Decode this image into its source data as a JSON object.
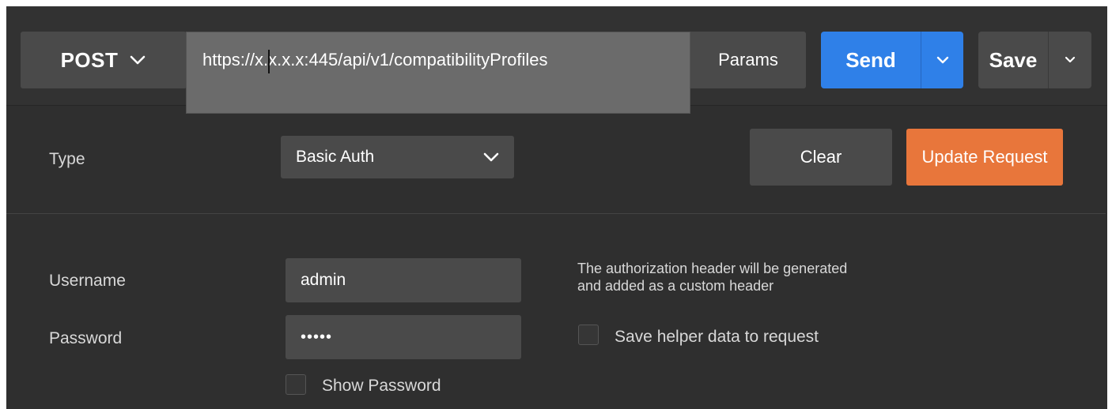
{
  "request": {
    "method": "POST",
    "url": "https://x.x.x.x:445/api/v1/compatibilityProfiles",
    "params_label": "Params",
    "send_label": "Send",
    "save_label": "Save"
  },
  "auth": {
    "type_label": "Type",
    "type_value": "Basic Auth",
    "clear_label": "Clear",
    "update_label": "Update Request",
    "username_label": "Username",
    "username_value": "admin",
    "password_label": "Password",
    "password_value": "•••••",
    "show_password_label": "Show Password",
    "note_line1": "The authorization header will be generated",
    "note_line2": "and added as a custom header",
    "save_helper_label": "Save helper data to request"
  },
  "colors": {
    "send_blue": "#2f80e8",
    "update_orange": "#e8763b",
    "panel_bg": "#2f2f2f"
  },
  "icons": [
    "chevron-down-icon"
  ]
}
